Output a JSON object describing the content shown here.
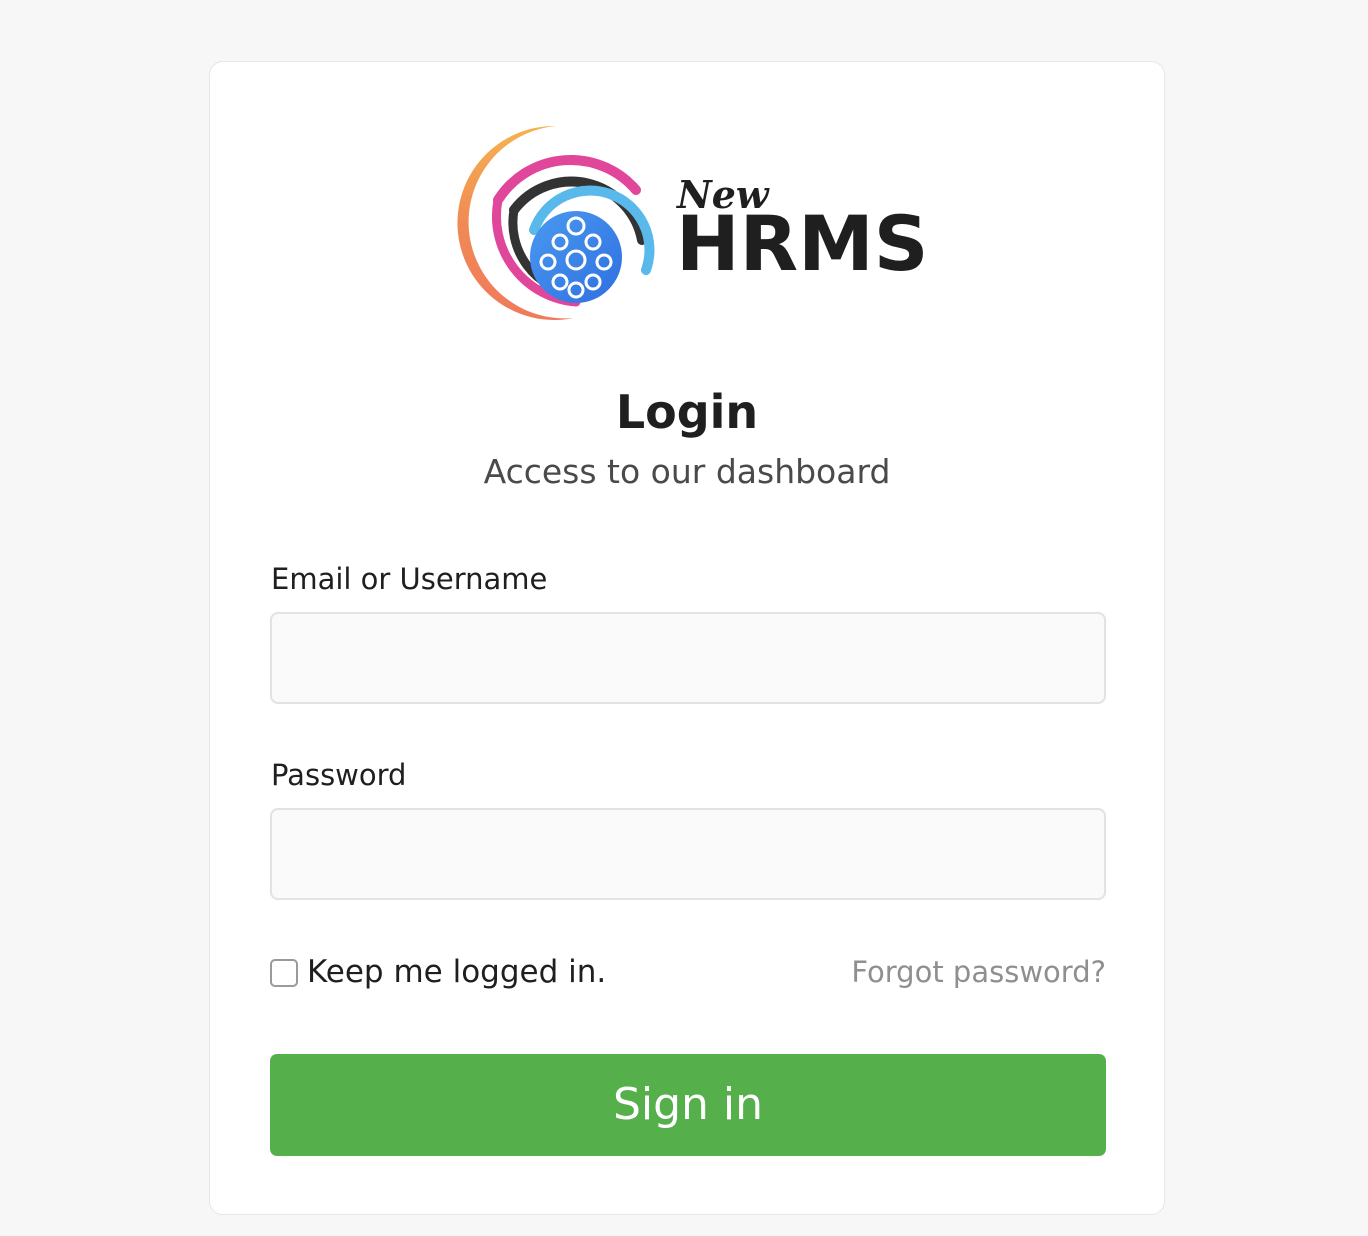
{
  "brand": {
    "logo_small_text": "New",
    "logo_big_text": "HRMS"
  },
  "header": {
    "title": "Login",
    "subtitle": "Access to our dashboard"
  },
  "form": {
    "email_label": "Email or Username",
    "email_value": "",
    "email_placeholder": "",
    "password_label": "Password",
    "password_value": "",
    "password_placeholder": "",
    "remember_label": "Keep me logged in.",
    "remember_checked": false,
    "forgot_label": "Forgot password?",
    "submit_label": "Sign in"
  },
  "colors": {
    "page_background": "#f7f7f7",
    "card_background": "#ffffff",
    "accent_green": "#55b04c",
    "link_gray": "#8f8f8f",
    "logo_blue": "#3b82ec",
    "logo_pink": "#e0469a",
    "logo_orange": "#f08a55",
    "logo_dark": "#333333"
  }
}
